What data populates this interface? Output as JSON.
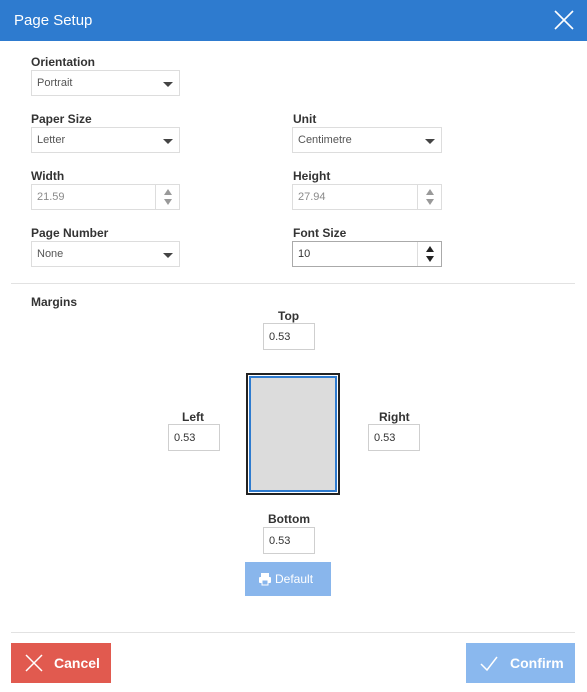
{
  "dialog": {
    "title": "Page Setup"
  },
  "orientation": {
    "label": "Orientation",
    "value": "Portrait"
  },
  "paper_size": {
    "label": "Paper Size",
    "value": "Letter"
  },
  "unit": {
    "label": "Unit",
    "value": "Centimetre"
  },
  "width": {
    "label": "Width",
    "value": "21.59"
  },
  "height": {
    "label": "Height",
    "value": "27.94"
  },
  "page_number": {
    "label": "Page Number",
    "value": "None"
  },
  "font_size": {
    "label": "Font Size",
    "value": "10"
  },
  "margins": {
    "label": "Margins",
    "top": {
      "label": "Top",
      "value": "0.53"
    },
    "left": {
      "label": "Left",
      "value": "0.53"
    },
    "right": {
      "label": "Right",
      "value": "0.53"
    },
    "bottom": {
      "label": "Bottom",
      "value": "0.53"
    }
  },
  "buttons": {
    "default": "Default",
    "cancel": "Cancel",
    "confirm": "Confirm"
  },
  "icons": {
    "close": "close-icon",
    "printer": "printer-icon",
    "cancel": "x-icon",
    "confirm": "check-icon"
  },
  "colors": {
    "titlebar": "#2e7bcf",
    "cancel": "#e15a4f",
    "confirm": "#8ab8ee",
    "default": "#89b6ec"
  }
}
